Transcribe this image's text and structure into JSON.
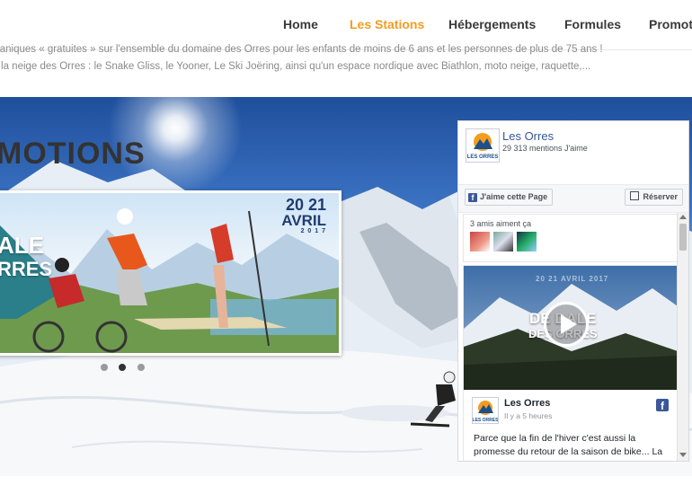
{
  "nav": {
    "items": [
      {
        "label": "Home",
        "active": false
      },
      {
        "label": "Les Stations",
        "active": true
      },
      {
        "label": "Hébergements",
        "active": false
      },
      {
        "label": "Formules",
        "active": false
      },
      {
        "label": "Promoti",
        "active": false
      }
    ],
    "active_color": "#f39c1f"
  },
  "intro": {
    "line1": "caniques « gratuites » sur l'ensemble du domaine des Orres pour les enfants de moins de 6 ans et les personnes de plus de 75 ans !",
    "line2": "r la neige des Orres : le Snake Gliss, le Yooner, Le Ski Joëring, ainsi qu'un espace nordique avec Biathlon, moto neige, raquette,..."
  },
  "hero": {
    "title": "MOTIONS",
    "promo": {
      "date_main": "20 21",
      "date_month": "AVRIL",
      "date_year": "2 0 1 7",
      "brand_a": "ALE",
      "brand_b": "RRES"
    },
    "carousel": {
      "count": 3,
      "active_index": 1
    }
  },
  "facebook": {
    "page_name": "Les Orres",
    "likes_text": "29 313 mentions J'aime",
    "logo_text": "LES ORRES",
    "like_button": "J'aime cette Page",
    "reserve_button": "Réserver",
    "friends_text": "3 amis aiment ça",
    "post": {
      "image_caption": "20 21 AVRIL 2017",
      "image_title_a": "DE DALE",
      "image_title_b": "DES ORRES",
      "author": "Les Orres",
      "time": "Il y a 5 heures",
      "text": "Parce que la fin de l'hiver c'est aussi la promesse du retour de la saison de bike... La"
    },
    "brand_color": "#3b5998"
  }
}
